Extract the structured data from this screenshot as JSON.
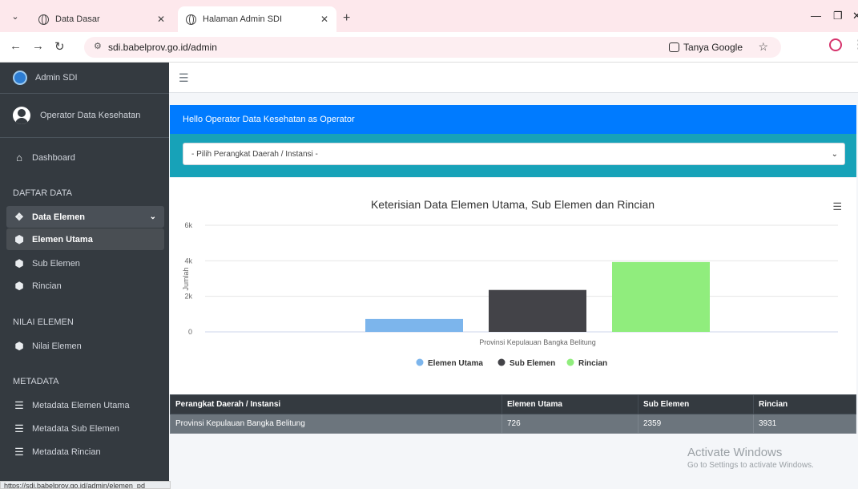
{
  "browser": {
    "tabs": [
      {
        "title": "Data Dasar",
        "active": false
      },
      {
        "title": "Halaman Admin SDI",
        "active": true
      }
    ],
    "url": "sdi.babelprov.go.id/admin",
    "ask_google": "Tanya Google",
    "status_url": "https://sdi.babelprov.go.id/admin/elemen_pd"
  },
  "sidebar": {
    "brand": "Admin SDI",
    "user": "Operator Data Kesehatan",
    "dashboard": "Dashboard",
    "section_data": "DAFTAR DATA",
    "data_elemen": "Data Elemen",
    "elemen_utama": "Elemen Utama",
    "sub_elemen": "Sub Elemen",
    "rincian": "Rincian",
    "section_nilai": "NILAI ELEMEN",
    "nilai_elemen": "Nilai Elemen",
    "section_meta": "METADATA",
    "meta_utama": "Metadata Elemen Utama",
    "meta_sub": "Metadata Sub Elemen",
    "meta_rincian": "Metadata Rincian"
  },
  "main": {
    "greeting": "Hello Operator Data Kesehatan as Operator",
    "select_value": "- Pilih Perangkat Daerah / Instansi -"
  },
  "chart_data": {
    "type": "bar",
    "title": "Keterisian Data Elemen Utama, Sub Elemen dan Rincian",
    "ylabel": "Jumlah",
    "categories": [
      "Provinsi Kepulauan Bangka Belitung"
    ],
    "yticks": [
      "0",
      "2k",
      "4k",
      "6k"
    ],
    "ylim": [
      0,
      6000
    ],
    "legend_position": "bottom",
    "series": [
      {
        "name": "Elemen Utama",
        "values": [
          726
        ],
        "color": "#7cb5ec"
      },
      {
        "name": "Sub Elemen",
        "values": [
          2359
        ],
        "color": "#434348"
      },
      {
        "name": "Rincian",
        "values": [
          3931
        ],
        "color": "#90ed7d"
      }
    ]
  },
  "table": {
    "headers": [
      "Perangkat Daerah / Instansi",
      "Elemen Utama",
      "Sub Elemen",
      "Rincian"
    ],
    "rows": [
      [
        "Provinsi Kepulauan Bangka Belitung",
        "726",
        "2359",
        "3931"
      ]
    ]
  },
  "watermark": {
    "line1": "Activate Windows",
    "line2": "Go to Settings to activate Windows."
  }
}
